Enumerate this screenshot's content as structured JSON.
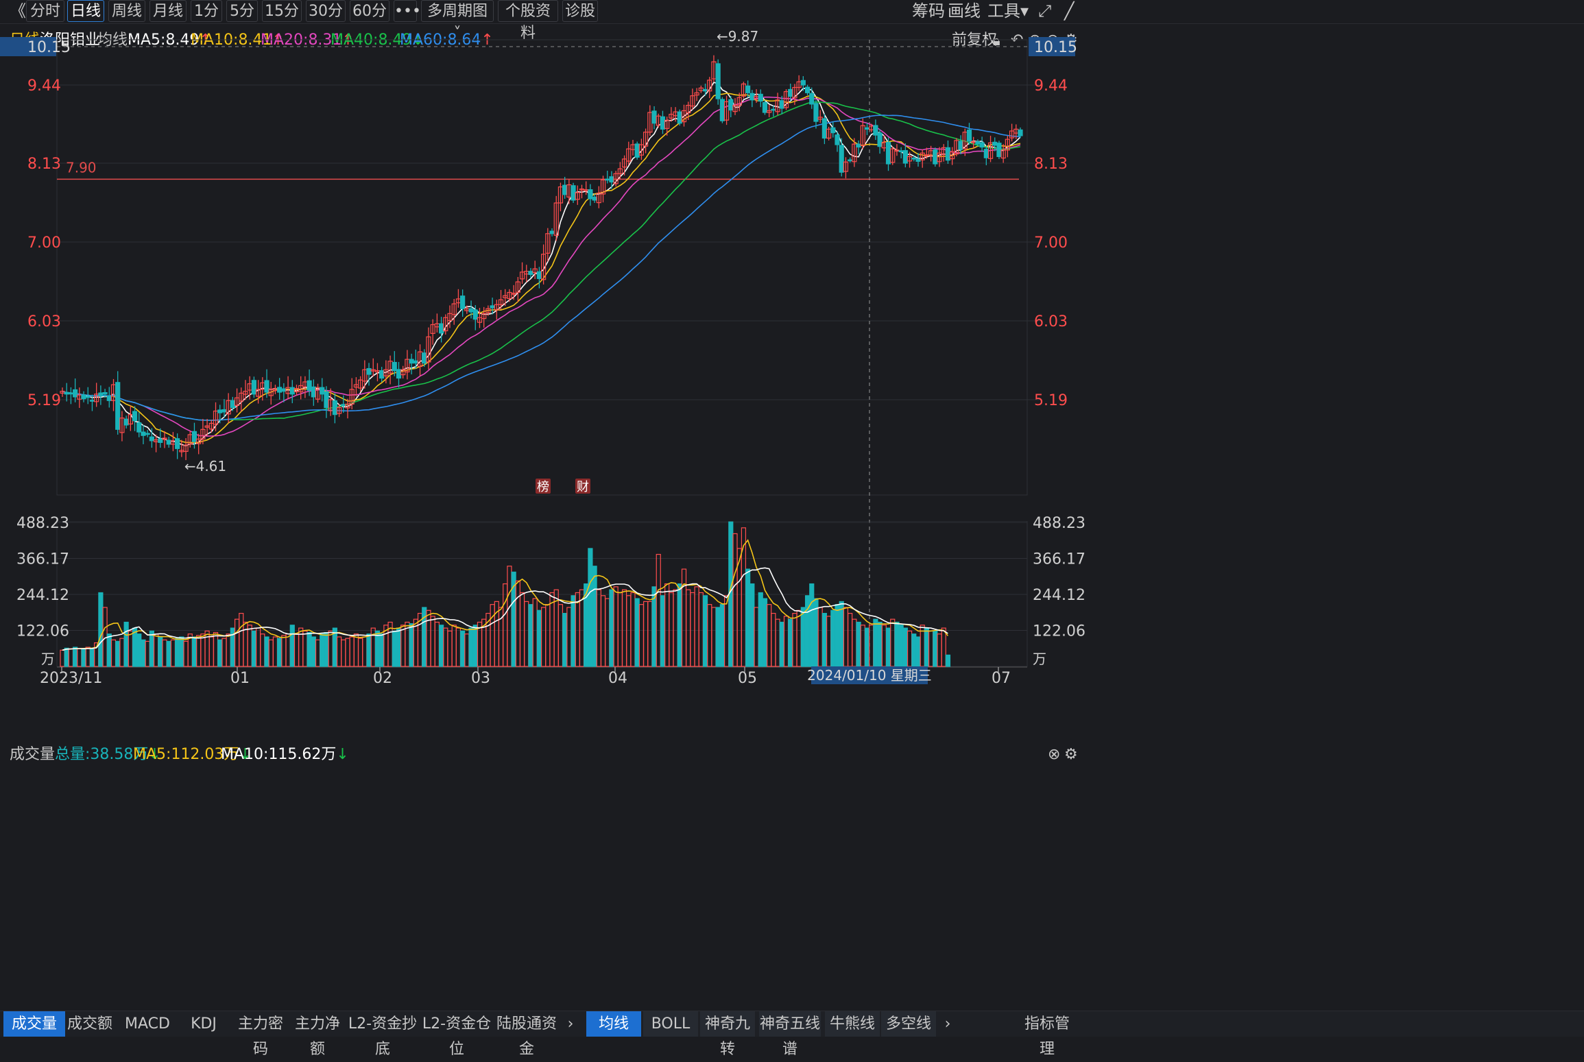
{
  "toolbar": {
    "back_icon": "double-chevron-left-icon",
    "tabs": [
      "分时",
      "日线",
      "周线",
      "月线",
      "1分",
      "5分",
      "15分",
      "30分",
      "60分",
      "•••",
      "多周期图",
      "个股资料",
      "诊股"
    ],
    "active_tab": "日线",
    "dropdown_arrow": "˅",
    "right_tools": [
      "筹码",
      "画线",
      "工具"
    ],
    "tool_dropdown_arrow": "▾",
    "expand_icon": "fullscreen-icon",
    "close_icon": "close-icon"
  },
  "infobar": {
    "period": "日线",
    "stock_name": "洛阳钼业",
    "label_avg": "均线",
    "ma": [
      {
        "text": "MA5:8.49",
        "arrow": "↑",
        "color": "#ffffff"
      },
      {
        "text": "MA10:8.41",
        "arrow": "↑",
        "color": "#f5c518"
      },
      {
        "text": "MA20:8.31",
        "arrow": "↑",
        "color": "#e548c0"
      },
      {
        "text": "MA40:8.49",
        "arrow": "↓",
        "color": "#19c24a"
      },
      {
        "text": "MA60:8.64",
        "arrow": "↑",
        "color": "#2f8ff0"
      }
    ],
    "adjust": "前复权",
    "icons": [
      "lock-icon",
      "undo-icon",
      "plus-circle-icon",
      "minus-circle-icon",
      "gear-icon"
    ]
  },
  "volume_bar": {
    "label": "成交量",
    "total": "总量:38.58万",
    "total_arrow": "↓",
    "ma5": "MA5:112.03万",
    "ma5_arrow": "↓",
    "ma10": "MA10:115.62万",
    "ma10_arrow": "↓",
    "icons": [
      "close-circle-icon",
      "gear-icon"
    ]
  },
  "chart_data": [
    {
      "type": "candlestick",
      "title": "洛阳钼业 日线",
      "ylim": [
        3.8,
        10.15
      ],
      "yticks": [
        "10.15",
        "9.44",
        "8.13",
        "7.00",
        "6.03",
        "5.19"
      ],
      "ytick_values": [
        10.15,
        9.44,
        8.13,
        7.0,
        6.03,
        5.19
      ],
      "reference_line": {
        "value": 7.9,
        "label": "7.90",
        "color": "#e24b4b"
      },
      "annotations": [
        {
          "text": "←9.87",
          "at": "high"
        },
        {
          "text": "←4.61",
          "at": "low"
        }
      ],
      "markers": [
        "榜",
        "财"
      ],
      "x_labels": [
        "2023/11",
        "01",
        "02",
        "03",
        "04",
        "05",
        "07"
      ],
      "crosshair_label": "2024/01/10 星期三",
      "ma_colors": {
        "ma5": "#ffffff",
        "ma10": "#f5c518",
        "ma20": "#e548c0",
        "ma40": "#19c24a",
        "ma60": "#2f8ff0"
      },
      "up_color": "#ff4d4d",
      "down_color": "#19b3b9",
      "closes": [
        5.28,
        5.25,
        5.26,
        5.22,
        5.24,
        5.2,
        5.22,
        5.18,
        5.25,
        5.23,
        5.25,
        5.18,
        5.35,
        4.85,
        4.98,
        4.9,
        5.02,
        4.95,
        4.82,
        4.78,
        4.8,
        4.72,
        4.73,
        4.7,
        4.75,
        4.68,
        4.72,
        4.63,
        4.61,
        4.67,
        4.79,
        4.71,
        4.74,
        4.85,
        4.89,
        4.92,
        5.06,
        5.04,
        5.05,
        5.18,
        5.1,
        5.21,
        5.26,
        5.28,
        5.36,
        5.25,
        5.3,
        5.37,
        5.27,
        5.3,
        5.31,
        5.27,
        5.28,
        5.32,
        5.25,
        5.31,
        5.34,
        5.38,
        5.29,
        5.22,
        5.32,
        5.25,
        5.1,
        5.19,
        5.02,
        5.1,
        5.12,
        5.14,
        5.3,
        5.35,
        5.4,
        5.51,
        5.46,
        5.51,
        5.5,
        5.42,
        5.51,
        5.6,
        5.5,
        5.42,
        5.51,
        5.62,
        5.58,
        5.58,
        5.7,
        5.58,
        5.86,
        5.99,
        6.0,
        5.9,
        6.07,
        6.12,
        6.24,
        6.3,
        6.18,
        6.18,
        6.14,
        6.05,
        6.07,
        6.12,
        6.18,
        6.19,
        6.23,
        6.29,
        6.34,
        6.38,
        6.37,
        6.51,
        6.63,
        6.64,
        6.6,
        6.67,
        6.55,
        6.85,
        7.12,
        7.12,
        7.56,
        7.79,
        7.68,
        7.82,
        7.6,
        7.71,
        7.76,
        7.75,
        7.62,
        7.6,
        7.7,
        7.89,
        7.9,
        7.86,
        7.98,
        8.05,
        8.2,
        8.37,
        8.44,
        8.23,
        8.44,
        8.65,
        8.98,
        8.8,
        8.92,
        8.7,
        8.85,
        8.95,
        8.99,
        8.8,
        9.01,
        9.1,
        9.26,
        9.31,
        9.39,
        9.34,
        9.53,
        9.87,
        9.21,
        8.84,
        9.16,
        9.02,
        9.1,
        9.23,
        9.46,
        9.31,
        9.19,
        9.25,
        9.17,
        8.98,
        9.01,
        9.03,
        9.19,
        9.05,
        9.33,
        9.25,
        9.4,
        9.5,
        9.44,
        9.31,
        9.12,
        8.83,
        8.9,
        8.55,
        8.7,
        8.64,
        8.44,
        8.0,
        8.15,
        8.18,
        8.45,
        8.4,
        8.76,
        8.7,
        8.75,
        8.6,
        8.41,
        8.48,
        8.12,
        8.37,
        8.35,
        8.33,
        8.13,
        8.24,
        8.2,
        8.16,
        8.3,
        8.27,
        8.34,
        8.12,
        8.3,
        8.39,
        8.18,
        8.32,
        8.51,
        8.36,
        8.65,
        8.5,
        8.49,
        8.45,
        8.4,
        8.22,
        8.47,
        8.43,
        8.24,
        8.35,
        8.53,
        8.67,
        8.7,
        8.59
      ]
    },
    {
      "type": "bar",
      "title": "成交量",
      "unit": "万",
      "ylim": [
        0,
        488.23
      ],
      "yticks": [
        "488.23",
        "366.17",
        "244.12",
        "122.06",
        "万"
      ],
      "ytick_values": [
        488.23,
        366.17,
        244.12,
        122.06
      ],
      "up_color": "#ff4d4d",
      "down_color": "#19b3b9",
      "ma5_color": "#f5c518",
      "ma10_color": "#ffffff",
      "values": [
        55,
        62,
        60,
        65,
        60,
        58,
        65,
        62,
        80,
        250,
        200,
        110,
        90,
        85,
        95,
        150,
        120,
        130,
        110,
        90,
        85,
        120,
        110,
        100,
        90,
        85,
        90,
        95,
        100,
        85,
        110,
        100,
        105,
        110,
        120,
        100,
        115,
        90,
        95,
        110,
        130,
        160,
        180,
        150,
        140,
        120,
        130,
        110,
        100,
        90,
        100,
        95,
        105,
        110,
        140,
        110,
        130,
        120,
        115,
        100,
        90,
        110,
        115,
        120,
        130,
        100,
        90,
        95,
        100,
        110,
        95,
        100,
        110,
        130,
        120,
        110,
        140,
        150,
        120,
        130,
        140,
        150,
        145,
        160,
        180,
        200,
        190,
        170,
        150,
        140,
        130,
        120,
        140,
        130,
        120,
        110,
        130,
        140,
        150,
        160,
        180,
        210,
        220,
        200,
        280,
        340,
        320,
        290,
        250,
        220,
        210,
        230,
        190,
        200,
        210,
        250,
        260,
        210,
        180,
        200,
        240,
        250,
        260,
        280,
        400,
        340,
        260,
        240,
        230,
        260,
        270,
        250,
        260,
        240,
        250,
        230,
        210,
        220,
        220,
        270,
        380,
        240,
        280,
        250,
        260,
        280,
        330,
        260,
        250,
        270,
        250,
        240,
        210,
        200,
        200,
        210,
        240,
        490,
        450,
        400,
        470,
        330,
        280,
        200,
        250,
        230,
        210,
        180,
        160,
        150,
        170,
        160,
        180,
        190,
        200,
        240,
        280,
        230,
        200,
        180,
        170,
        190,
        210,
        220,
        200,
        180,
        160,
        150,
        140,
        130,
        140,
        160,
        150,
        140,
        130,
        160,
        150,
        140,
        130,
        120,
        110,
        100,
        140,
        130,
        120,
        120,
        110,
        130,
        38.58
      ]
    }
  ]
}
